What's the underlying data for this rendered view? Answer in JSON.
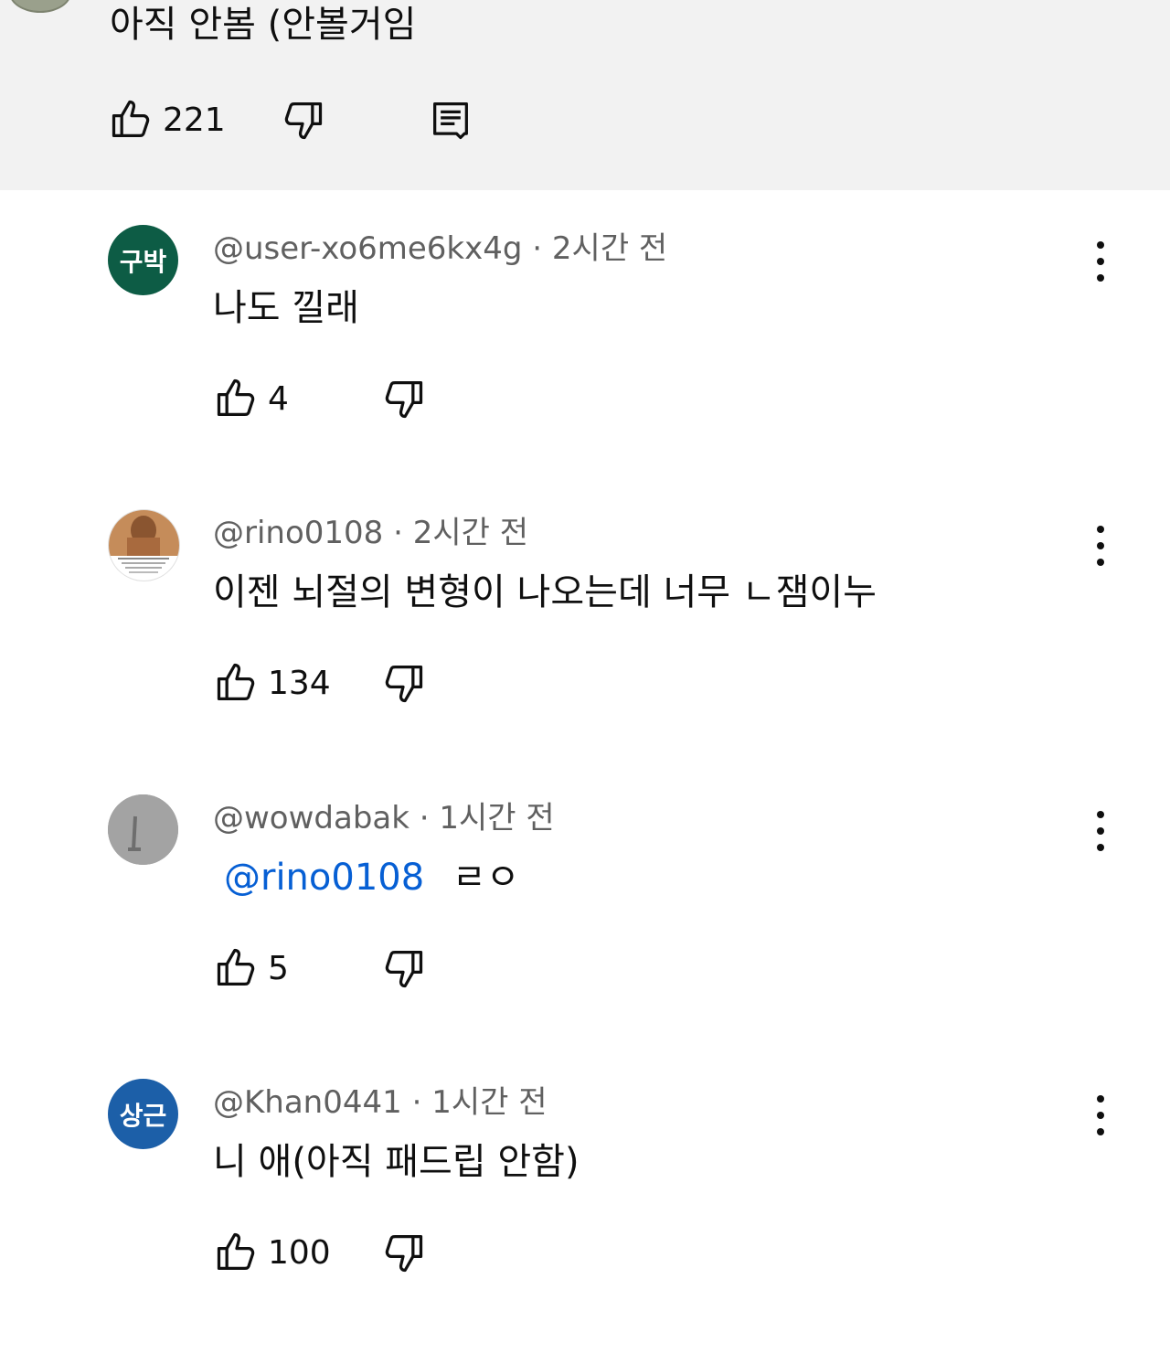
{
  "parent_comment": {
    "text": "아직 안봄 (안볼거임",
    "like_count": "221",
    "like_icon": "thumbs-up-icon",
    "dislike_icon": "thumbs-down-icon",
    "reply_icon": "comment-reply-icon"
  },
  "replies": [
    {
      "avatar_text": "구박",
      "avatar_color": "#0d5c45",
      "handle": "@user-xo6me6kx4g",
      "time": "2시간 전",
      "text": "나도 낄래",
      "mention": "",
      "likes": "4"
    },
    {
      "avatar_text": "",
      "avatar_color": "#b07a4c",
      "handle": "@rino0108",
      "time": "2시간 전",
      "text": "이젠 뇌절의 변형이 나오는데 너무 ㄴ잼이누",
      "mention": "",
      "likes": "134"
    },
    {
      "avatar_text": "",
      "avatar_color": "#9a9a9a",
      "handle": "@wowdabak",
      "time": "1시간 전",
      "text": "ㄹㅇ",
      "mention": "@rino0108",
      "likes": "5"
    },
    {
      "avatar_text": "상근",
      "avatar_color": "#1c5fa8",
      "handle": "@Khan0441",
      "time": "1시간 전",
      "text": "니 애(아직 패드립 안함)",
      "mention": "",
      "likes": "100"
    }
  ],
  "separator": "·",
  "menu_icon": "more-vertical-icon",
  "colors": {
    "parent_bg": "#f2f2f2",
    "mention_link": "#065fd4",
    "meta_text": "#606060"
  }
}
